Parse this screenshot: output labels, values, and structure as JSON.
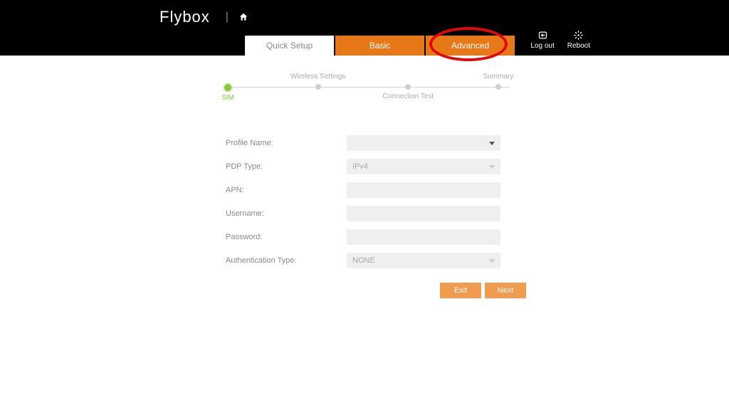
{
  "brand": "Flybox",
  "tabs": {
    "quick": "Quick Setup",
    "basic": "Basic",
    "advanced": "Advanced"
  },
  "actions": {
    "logout": "Log out",
    "reboot": "Reboot"
  },
  "steps": {
    "sim": "SIM",
    "wireless": "Wireless Settings",
    "conn": "Connection Test",
    "summary": "Summary"
  },
  "form": {
    "profile_name": {
      "label": "Profile Name:",
      "value": ""
    },
    "pdp_type": {
      "label": "PDP Type:",
      "value": "IPv4"
    },
    "apn": {
      "label": "APN:",
      "value": ""
    },
    "username": {
      "label": "Username:",
      "value": ""
    },
    "password": {
      "label": "Password:",
      "value": ""
    },
    "auth_type": {
      "label": "Authentication Type:",
      "value": "NONE"
    }
  },
  "buttons": {
    "exit": "Exit",
    "next": "Next"
  }
}
